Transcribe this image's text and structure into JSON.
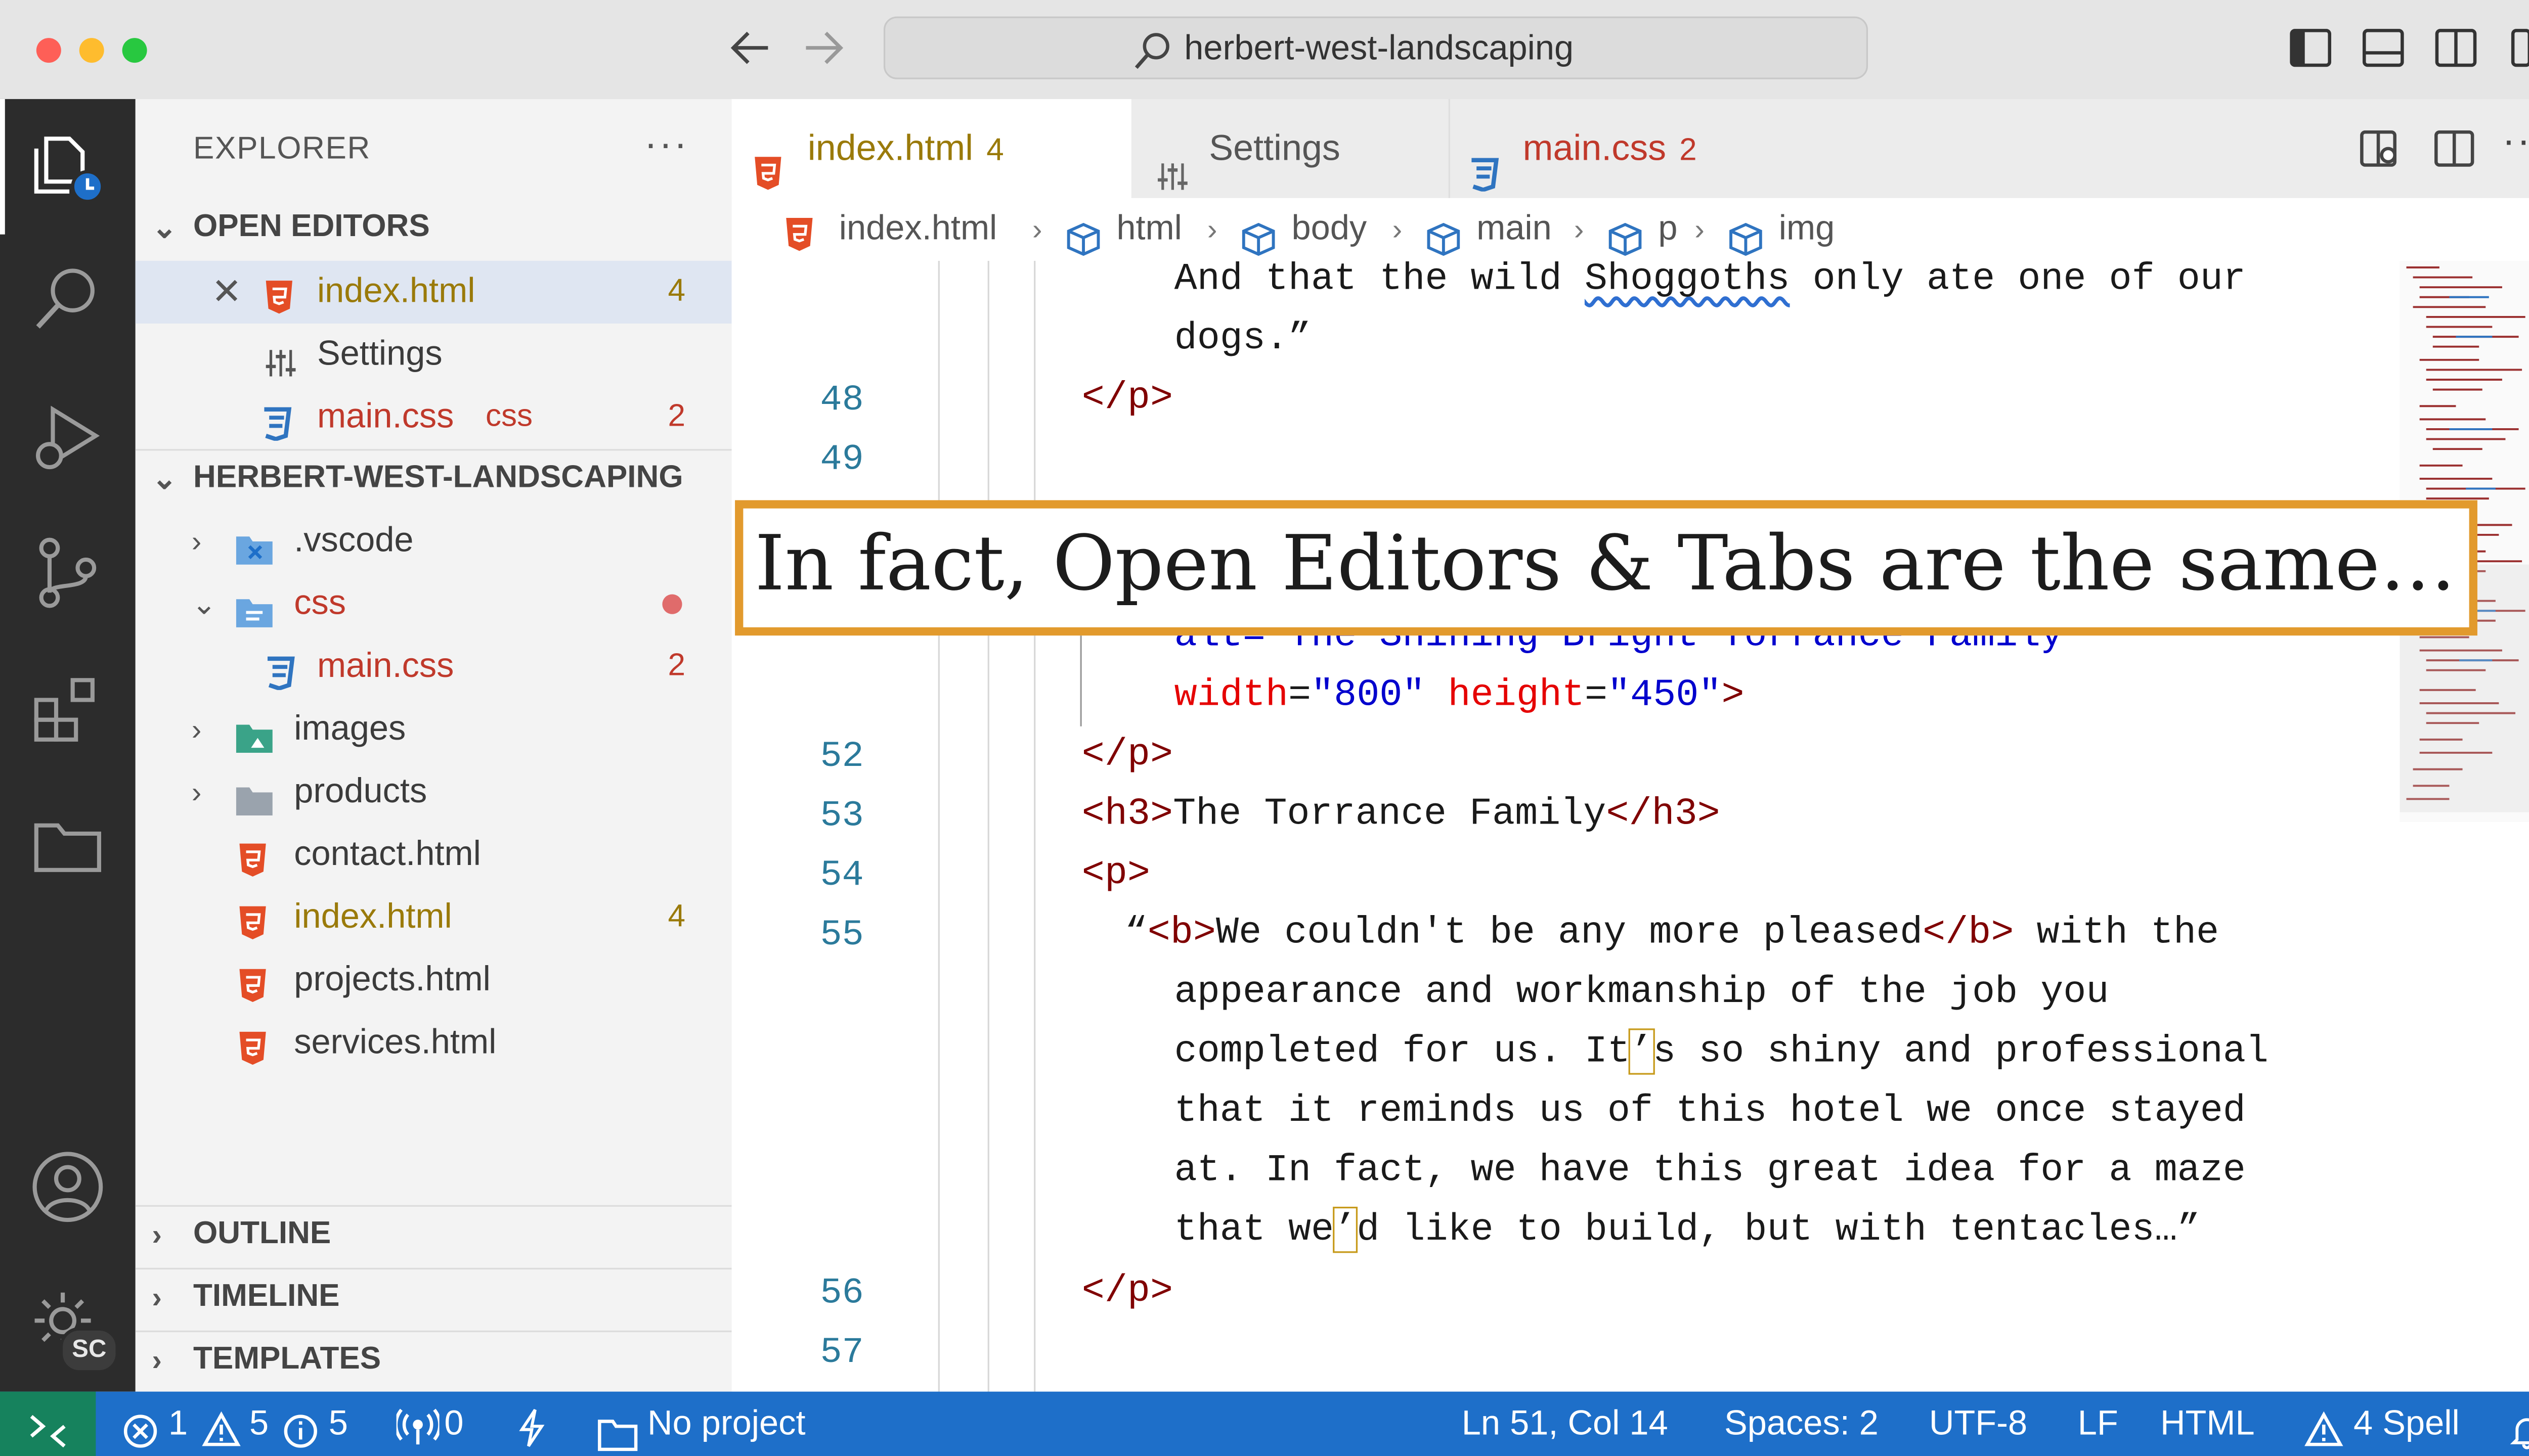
{
  "window": {
    "search_text": "herbert-west-landscaping"
  },
  "sidebar": {
    "title": "EXPLORER",
    "more": "···",
    "open_editors": {
      "header": "OPEN EDITORS",
      "items": [
        {
          "name": "index.html",
          "count": "4"
        },
        {
          "name": "Settings"
        },
        {
          "name": "main.css",
          "lang": "css",
          "count": "2"
        }
      ]
    },
    "folder": {
      "header": "HERBERT-WEST-LANDSCAPING",
      "items": [
        {
          "name": ".vscode"
        },
        {
          "name": "css"
        },
        {
          "name": "main.css",
          "count": "2"
        },
        {
          "name": "images"
        },
        {
          "name": "products"
        },
        {
          "name": "contact.html"
        },
        {
          "name": "index.html",
          "count": "4"
        },
        {
          "name": "projects.html"
        },
        {
          "name": "services.html"
        }
      ]
    },
    "outline": "OUTLINE",
    "timeline": "TIMELINE",
    "templates": "TEMPLATES"
  },
  "tabs": [
    {
      "label": "index.html",
      "count": "4"
    },
    {
      "label": "Settings"
    },
    {
      "label": "main.css",
      "count": "2"
    }
  ],
  "breadcrumb": [
    "index.html",
    "html",
    "body",
    "main",
    "p",
    "img"
  ],
  "editor": {
    "line_numbers": {
      "l48": "48",
      "l49": "49",
      "l52": "52",
      "l53": "53",
      "l54": "54",
      "l55": "55",
      "l56": "56",
      "l57": "57"
    },
    "code": {
      "wrap1a": "And that the wild ",
      "wrap1b": "Shoggoths",
      "wrap1c": " only ate one of our",
      "wrap2": "dogs.”",
      "l48": "</p>",
      "partial": "alt=\"The Shining Bright Torrance Family\"",
      "img_width_attr": "width",
      "img_width_val": "\"800\"",
      "img_height_attr": "height",
      "img_height_val": "\"450\"",
      "img_close": ">",
      "l52": "</p>",
      "l53_open": "<h3>",
      "l53_text": "The Torrance Family",
      "l53_close": "</h3>",
      "l54": "<p>",
      "l55_quote": "“",
      "l55_b_open": "<b>",
      "l55_b_text": "We couldn't be any more pleased",
      "l55_b_close": "</b>",
      "l55_rest": " with the",
      "w2": "appearance and workmanship of the job you",
      "w3a": "completed for us. It",
      "w3b": "’",
      "w3c": "s so shiny and professional",
      "w4": "that it reminds us of this hotel we once stayed",
      "w5": "at. In fact, we have this great idea for a maze",
      "w6a": "that we",
      "w6b": "’",
      "w6c": "d like to build, but with tentacles…”",
      "l56": "</p>"
    }
  },
  "banner": "In fact, Open Editors & Tabs are the same…",
  "activity": {
    "account_badge": "SC"
  },
  "status": {
    "errors": "1",
    "warnings": "5",
    "infos": "5",
    "ports": "0",
    "project": "No project",
    "position": "Ln 51, Col 14",
    "spaces": "Spaces: 2",
    "encoding": "UTF-8",
    "eol": "LF",
    "language": "HTML",
    "spell": "4 Spell"
  },
  "colors": {
    "statusbar": "#1e6fc9",
    "remote": "#16825d",
    "activitybar": "#2c2c2c",
    "banner_border": "#e29a2d",
    "html_icon": "#e44d26",
    "css_icon": "#2f74c0"
  }
}
